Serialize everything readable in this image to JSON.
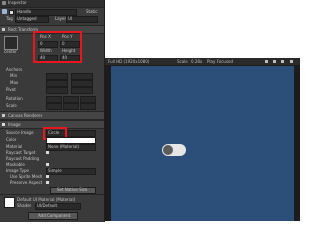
{
  "inspector": {
    "tab_title": "Inspector",
    "object_name": "Handle",
    "static_label": "Static",
    "tag_label": "Tag",
    "tag_value": "Untagged",
    "layer_label": "Layer",
    "layer_value": "UI",
    "rect_transform": {
      "title": "Rect Transform",
      "anchor_label": "center",
      "pos_x_label": "Pos X",
      "pos_y_label": "Pos Y",
      "pos_x": "0",
      "pos_y": "0",
      "width_label": "Width",
      "height_label": "Height",
      "width": "40",
      "height": "40",
      "anchors_label": "Anchors",
      "min_label": "Min",
      "max_label": "Max",
      "pivot_label": "Pivot",
      "rotation_label": "Rotation",
      "scale_label": "Scale"
    },
    "canvas_renderer": {
      "title": "Canvas Renderer"
    },
    "image": {
      "title": "Image",
      "source_image_label": "Source Image",
      "source_image_value": "Circle",
      "color_label": "Color",
      "material_label": "Material",
      "material_value": "None (Material)",
      "raycast_target_label": "Raycast Target",
      "raycast_padding_label": "Raycast Padding",
      "maskable_label": "Maskable",
      "image_type_label": "Image Type",
      "image_type_value": "Simple",
      "use_sprite_mesh_label": "Use Sprite Mesh",
      "preserve_aspect_label": "Preserve Aspect",
      "set_native_size_label": "Set Native Size"
    },
    "material_section": {
      "title": "Default UI Material (Material)",
      "shader_label": "Shader",
      "shader_value": "UI/Default"
    },
    "add_component_label": "Add Component"
  },
  "game": {
    "resolution_label": "Full HD (1920x1080)",
    "scale_label": "Scale",
    "scale_value": "0.28x",
    "play_focused_label": "Play Focused",
    "canvas_color": "#2c4f7a"
  }
}
